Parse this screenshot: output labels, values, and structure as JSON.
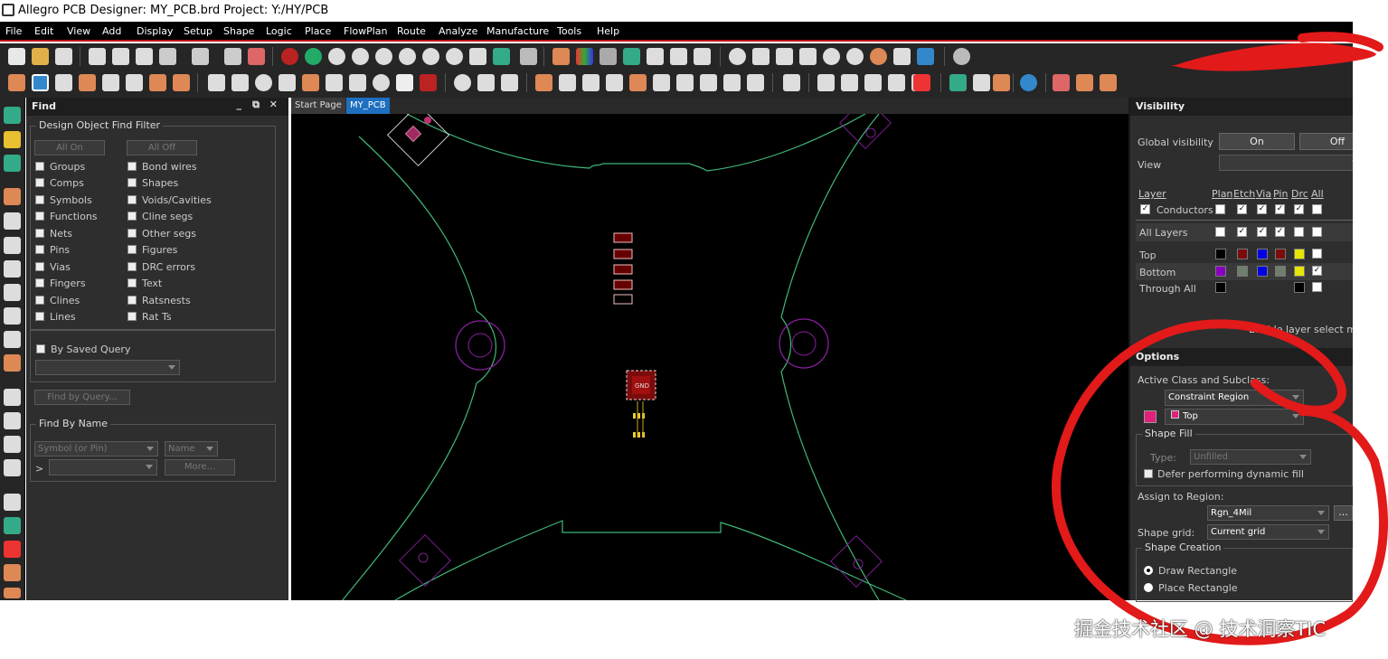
{
  "window": {
    "title": "Allegro PCB Designer: MY_PCB.brd  Project: Y:/HY/PCB"
  },
  "menu": [
    "File",
    "Edit",
    "View",
    "Add",
    "Display",
    "Setup",
    "Shape",
    "Logic",
    "Place",
    "FlowPlan",
    "Route",
    "Analyze",
    "Manufacture",
    "Tools",
    "Help"
  ],
  "find": {
    "title": "Find",
    "filter_title": "Design Object Find Filter",
    "all_on": "All On",
    "all_off": "All Off",
    "left_items": [
      "Groups",
      "Comps",
      "Symbols",
      "Functions",
      "Nets",
      "Pins",
      "Vias",
      "Fingers",
      "Clines",
      "Lines"
    ],
    "right_items": [
      "Bond wires",
      "Shapes",
      "Voids/Cavities",
      "Cline segs",
      "Other segs",
      "Figures",
      "DRC errors",
      "Text",
      "Ratsnests",
      "Rat Ts"
    ],
    "saved_query": "By Saved Query",
    "find_by_query": "Find by Query...",
    "find_by_name": "Find By Name",
    "symbol_dropdown": "Symbol (or Pin)",
    "name_dropdown": "Name",
    "prompt": ">",
    "more": "More..."
  },
  "tabs": [
    "Start Page",
    "MY_PCB"
  ],
  "canvas": {
    "gnd_label": "GND"
  },
  "visibility": {
    "title": "Visibility",
    "global_label": "Global visibility",
    "on": "On",
    "off": "Off",
    "view_label": "View",
    "cols": [
      "Layer",
      "Plan",
      "Etch",
      "Via",
      "Pin",
      "Drc",
      "All"
    ],
    "conductors": "Conductors",
    "all_layers": "All Layers",
    "top": "Top",
    "bottom": "Bottom",
    "through_all": "Through All",
    "enable_layer_select": "Enable layer select mod",
    "colors": {
      "top": [
        "#000000",
        "#7a0c0c",
        "#0000e6",
        "#7a0c0c",
        "#e6e600",
        "#ffffff"
      ],
      "bottom": [
        "#8a00c0",
        "#6e7f6e",
        "#0000e6",
        "#6e7f6e",
        "#e6e600",
        "#ffffff"
      ],
      "through": [
        "#000000",
        "#000000",
        "#ffffff"
      ]
    }
  },
  "options": {
    "title": "Options",
    "active_class_label": "Active Class and Subclass:",
    "class_value": "Constraint Region",
    "subclass_value": "Top",
    "subclass_color": "#e0207a",
    "shape_fill": "Shape Fill",
    "type_label": "Type:",
    "type_value": "Unfilled",
    "defer_label": "Defer performing dynamic fill",
    "assign_label": "Assign to Region:",
    "region_value": "Rgn_4Mil",
    "ellipsis": "...",
    "grid_label": "Shape grid:",
    "grid_value": "Current grid",
    "creation_title": "Shape Creation",
    "draw_rect": "Draw Rectangle",
    "place_rect": "Place Rectangle"
  },
  "watermark": "掘金技术社区 @ 技术洞察TIC",
  "colors": {
    "accent_red": "#c0141a",
    "board_outline": "#3fb878",
    "mount_hole": "#8a1fa0",
    "tab_active": "#1e6fc0"
  }
}
